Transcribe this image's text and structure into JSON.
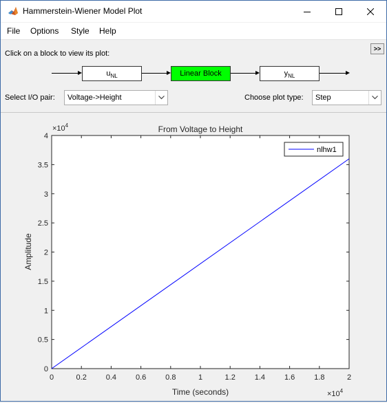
{
  "window": {
    "title": "Hammerstein-Wiener Model Plot"
  },
  "menu": [
    "File",
    "Options",
    "Style",
    "Help"
  ],
  "panel": {
    "instruction": "Click on a block to view its plot:",
    "toggle_label": ">>",
    "blocks": {
      "input_nl": "u",
      "input_nl_sub": "NL",
      "linear": "Linear Block",
      "output_nl": "y",
      "output_nl_sub": "NL"
    },
    "io_label": "Select I/O pair:",
    "io_value": "Voltage->Height",
    "plot_type_label": "Choose plot type:",
    "plot_type_value": "Step"
  },
  "chart_data": {
    "type": "line",
    "title": "From Voltage to Height",
    "xlabel": "Time (seconds)",
    "ylabel": "Amplitude",
    "x_exponent": "×10",
    "x_exponent_power": "4",
    "y_exponent": "×10",
    "y_exponent_power": "4",
    "xlim": [
      0,
      20000
    ],
    "ylim": [
      0,
      40000
    ],
    "xticks": [
      0,
      0.2,
      0.4,
      0.6,
      0.8,
      1,
      1.2,
      1.4,
      1.6,
      1.8,
      2
    ],
    "xtick_labels": [
      "0",
      "0.2",
      "0.4",
      "0.6",
      "0.8",
      "1",
      "1.2",
      "1.4",
      "1.6",
      "1.8",
      "2"
    ],
    "yticks": [
      0,
      0.5,
      1,
      1.5,
      2,
      2.5,
      3,
      3.5,
      4
    ],
    "ytick_labels": [
      "0",
      "0.5",
      "1",
      "1.5",
      "2",
      "2.5",
      "3",
      "3.5",
      "4"
    ],
    "legend_position": "top-right",
    "series": [
      {
        "name": "nlhw1",
        "color": "#0000ff",
        "x": [
          0,
          20000
        ],
        "y": [
          0,
          36000
        ]
      }
    ]
  }
}
